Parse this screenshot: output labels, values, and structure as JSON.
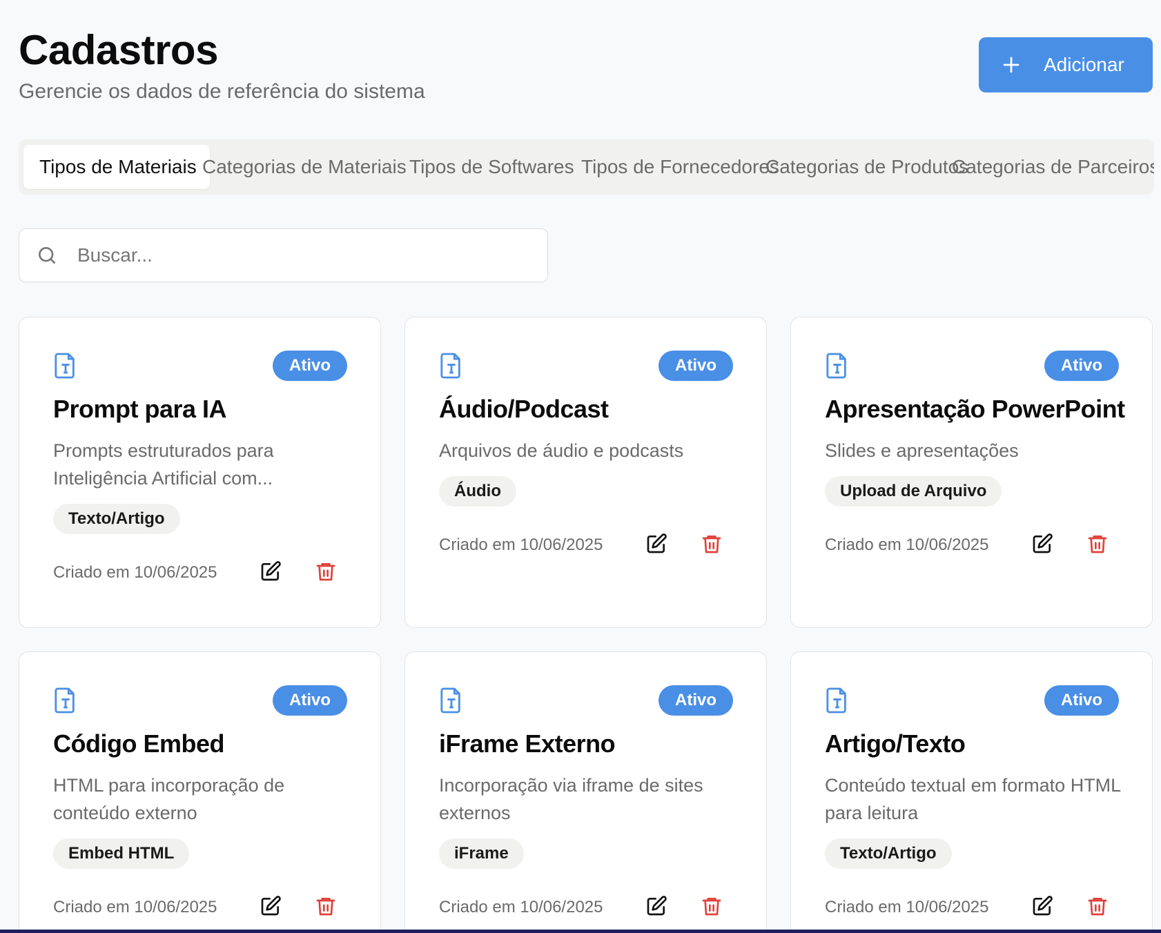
{
  "header": {
    "title": "Cadastros",
    "subtitle": "Gerencie os dados de referência do sistema",
    "add_label": "Adicionar"
  },
  "tabs": [
    {
      "label": "Tipos de Materiais",
      "active": true
    },
    {
      "label": "Categorias de Materiais",
      "active": false
    },
    {
      "label": "Tipos de Softwares",
      "active": false
    },
    {
      "label": "Tipos de Fornecedores",
      "active": false
    },
    {
      "label": "Categorias de Produtos",
      "active": false
    },
    {
      "label": "Categorias de Parceiros",
      "active": false
    }
  ],
  "search": {
    "placeholder": "Buscar..."
  },
  "colors": {
    "accent": "#4a8fe6",
    "danger": "#e0413a",
    "tag_bg": "#f1f1ef"
  },
  "icons": {
    "card": "file-type-icon",
    "add": "plus-icon",
    "search": "search-icon",
    "edit": "edit-icon",
    "delete": "trash-icon"
  },
  "cards": [
    {
      "title": "Prompt para IA",
      "description": "Prompts estruturados para Inteligência Artificial com...",
      "tag": "Texto/Artigo",
      "status": "Ativo",
      "created": "Criado em 10/06/2025"
    },
    {
      "title": "Áudio/Podcast",
      "description": "Arquivos de áudio e podcasts",
      "tag": "Áudio",
      "status": "Ativo",
      "created": "Criado em 10/06/2025"
    },
    {
      "title": "Apresentação PowerPoint",
      "description": "Slides e apresentações",
      "tag": "Upload de Arquivo",
      "status": "Ativo",
      "created": "Criado em 10/06/2025"
    },
    {
      "title": "Código Embed",
      "description": "HTML para incorporação de conteúdo externo",
      "tag": "Embed HTML",
      "status": "Ativo",
      "created": "Criado em 10/06/2025"
    },
    {
      "title": "iFrame Externo",
      "description": "Incorporação via iframe de sites externos",
      "tag": "iFrame",
      "status": "Ativo",
      "created": "Criado em 10/06/2025"
    },
    {
      "title": "Artigo/Texto",
      "description": "Conteúdo textual em formato HTML para leitura",
      "tag": "Texto/Artigo",
      "status": "Ativo",
      "created": "Criado em 10/06/2025"
    }
  ]
}
